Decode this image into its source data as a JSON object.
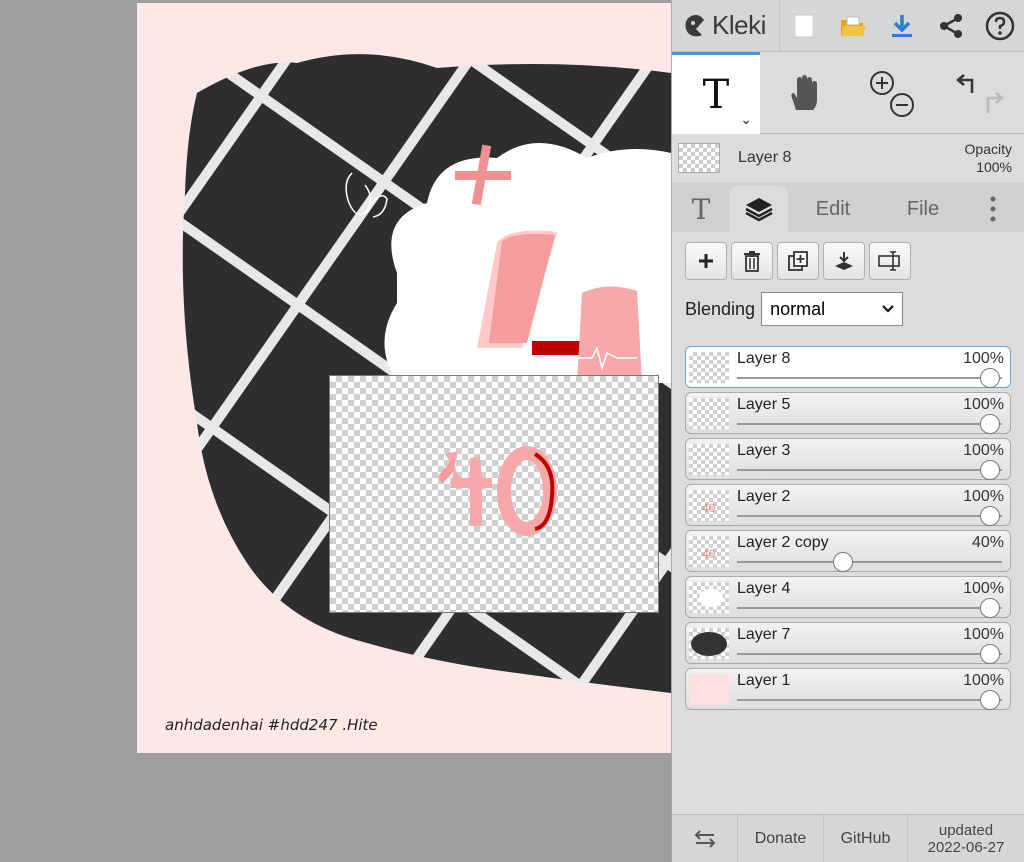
{
  "canvas": {
    "signature": "anhdadenhai #hdd247 .Hite"
  },
  "topbar": {
    "app_name": "Kleki",
    "buttons": [
      "new-image-icon",
      "open-folder-icon",
      "download-icon",
      "share-icon",
      "help-icon"
    ]
  },
  "tools": {
    "items": [
      {
        "name": "text-tool",
        "active": true
      },
      {
        "name": "hand-tool",
        "active": false
      },
      {
        "name": "zoom",
        "active": false
      },
      {
        "name": "undo-redo",
        "active": false
      }
    ]
  },
  "current_layer": {
    "name": "Layer 8",
    "opacity_label": "Opacity",
    "opacity_value": "100%"
  },
  "tabs": {
    "edit": "Edit",
    "file": "File"
  },
  "blending": {
    "label": "Blending",
    "value": "normal"
  },
  "layers": [
    {
      "name": "Layer 8",
      "opacity": "100%",
      "opacity_fraction": 1.0,
      "selected": true
    },
    {
      "name": "Layer 5",
      "opacity": "100%",
      "opacity_fraction": 1.0,
      "selected": false
    },
    {
      "name": "Layer 3",
      "opacity": "100%",
      "opacity_fraction": 1.0,
      "selected": false
    },
    {
      "name": "Layer 2",
      "opacity": "100%",
      "opacity_fraction": 1.0,
      "selected": false
    },
    {
      "name": "Layer 2 copy",
      "opacity": "40%",
      "opacity_fraction": 0.4,
      "selected": false
    },
    {
      "name": "Layer 4",
      "opacity": "100%",
      "opacity_fraction": 1.0,
      "selected": false
    },
    {
      "name": "Layer 7",
      "opacity": "100%",
      "opacity_fraction": 1.0,
      "selected": false
    },
    {
      "name": "Layer 1",
      "opacity": "100%",
      "opacity_fraction": 1.0,
      "selected": false
    }
  ],
  "footer": {
    "donate": "Donate",
    "github": "GitHub",
    "updated_label": "updated",
    "updated_date": "2022-06-27"
  },
  "colors": {
    "accent": "#4a9ae1",
    "panel_bg": "#dcdcdc",
    "canvas_bg": "#fde8e8",
    "pink": "#f7a8a8",
    "red": "#c00000"
  }
}
